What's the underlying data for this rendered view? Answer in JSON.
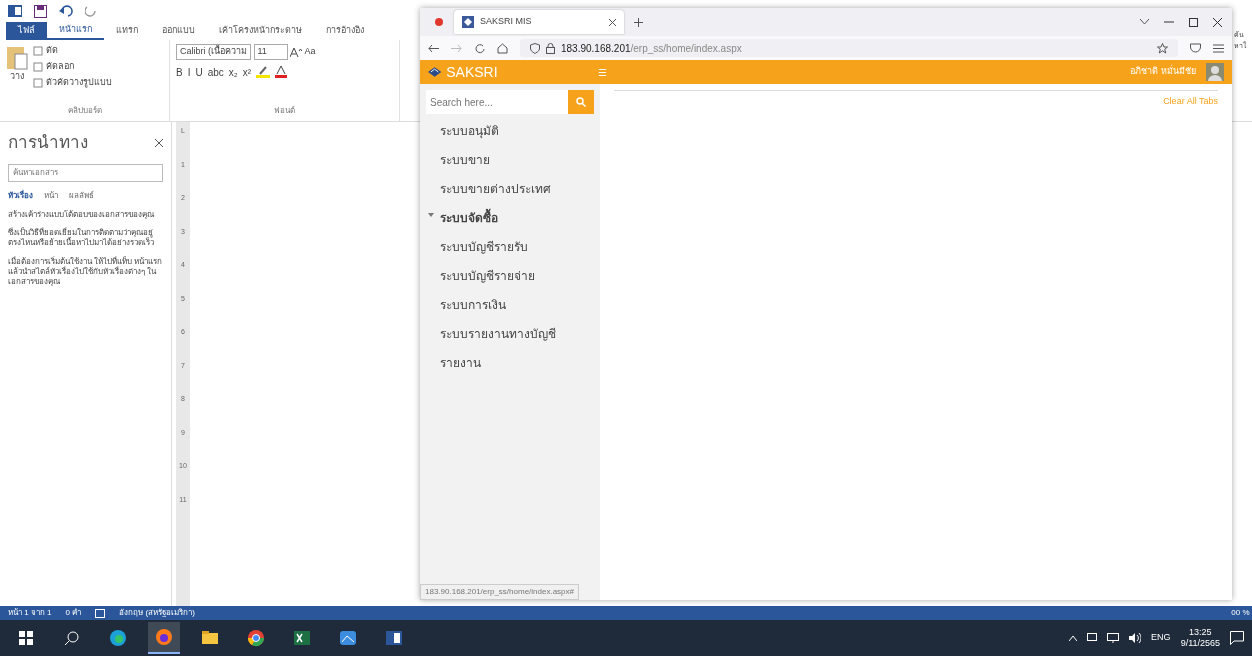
{
  "word": {
    "ribbon_tabs": [
      {
        "label": "ไฟล์",
        "selected": false,
        "kind": "file"
      },
      {
        "label": "หน้าแรก",
        "selected": true,
        "kind": "tab"
      },
      {
        "label": "แทรก",
        "selected": false,
        "kind": "tab"
      },
      {
        "label": "ออกแบบ",
        "selected": false,
        "kind": "tab"
      },
      {
        "label": "เค้าโครงหน้ากระดาษ",
        "selected": false,
        "kind": "tab"
      },
      {
        "label": "การอ้างอิง",
        "selected": false,
        "kind": "tab"
      }
    ],
    "clipboard": {
      "paste": "วาง",
      "cut": "ตัด",
      "copy": "คัดลอก",
      "format_painter": "ตัวคัดวางรูปแบบ",
      "group_label": "คลิปบอร์ด"
    },
    "font": {
      "name": "Calibri (เนื้อความ",
      "size": "11",
      "case": "Aa",
      "format_buttons": [
        "B",
        "I",
        "U",
        "abc",
        "x₂",
        "x²"
      ],
      "group_label": "ฟอนต์"
    },
    "navigation": {
      "title": "การนำทาง",
      "search_placeholder": "ค้นหาเอกสาร",
      "tabs": [
        {
          "label": "หัวเรื่อง",
          "selected": true
        },
        {
          "label": "หน้า",
          "selected": false
        },
        {
          "label": "ผลลัพธ์",
          "selected": false
        }
      ],
      "paragraphs": [
        "สร้างเค้าร่างแบบโต้ตอบของเอกสารของคุณ",
        "ซึ่งเป็นวิธีที่ยอดเยี่ยมในการติดตามว่าคุณอยู่ตรงไหนหรือย้ายเนื้อหาไปมาได้อย่างรวดเร็ว",
        "เมื่อต้องการเริ่มต้นใช้งาน ให้ไปที่แท็บ หน้าแรก แล้วนำสไตล์หัวเรื่องไปใช้กับหัวเรื่องต่างๆ ในเอกสารของคุณ"
      ]
    },
    "ruler_corner": "L",
    "ruler_marks": [
      "1",
      "2",
      "3",
      "4",
      "5",
      "6",
      "7",
      "8",
      "9",
      "10",
      "11"
    ],
    "right_edge_text": "ค้นหาใ",
    "status_bar": {
      "page": "หน้า 1 จาก 1",
      "words": "0 คำ",
      "language": "อังกฤษ (สหรัฐอเมริกา)",
      "zoom": "00 %"
    }
  },
  "browser": {
    "tab_title": "SAKSRI MIS",
    "url_host": "183.90.168.201",
    "url_path": "/erp_ss/home/index.aspx",
    "app": {
      "brand": "SAKSRI",
      "menu_glyph": "☰",
      "user_name": "อภิชาติ หมั่นมีชัย",
      "search_placeholder": "Search here...",
      "clear_tabs": "Clear All Tabs",
      "menu": [
        {
          "label": "ระบบอนุมัติ",
          "has_submenu": false
        },
        {
          "label": "ระบบขาย",
          "has_submenu": false
        },
        {
          "label": "ระบบขายต่างประเทศ",
          "has_submenu": false
        },
        {
          "label": "ระบบจัดซื้อ",
          "has_submenu": true
        },
        {
          "label": "ระบบบัญชีรายรับ",
          "has_submenu": false
        },
        {
          "label": "ระบบบัญชีรายจ่าย",
          "has_submenu": false
        },
        {
          "label": "ระบบการเงิน",
          "has_submenu": false
        },
        {
          "label": "ระบบรายงานทางบัญชี",
          "has_submenu": false
        },
        {
          "label": "รายงาน",
          "has_submenu": false
        }
      ]
    },
    "status_url": "183.90.168.201/erp_ss/home/index.aspx#"
  },
  "taskbar": {
    "apps": [
      {
        "kind": "edge"
      },
      {
        "kind": "firefox",
        "selected": true
      },
      {
        "kind": "files"
      },
      {
        "kind": "chrome"
      },
      {
        "kind": "excel"
      },
      {
        "kind": "photos"
      },
      {
        "kind": "word"
      }
    ],
    "tray": {
      "language": "ENG",
      "time": "13:25",
      "date": "9/11/2565"
    }
  }
}
